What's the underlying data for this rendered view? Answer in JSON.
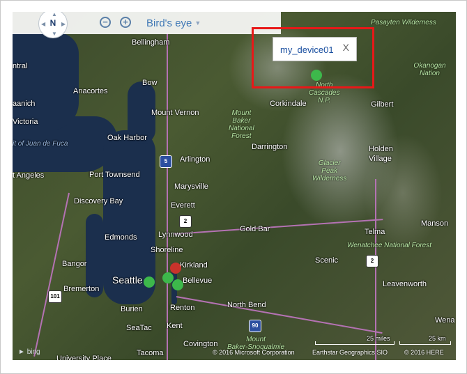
{
  "controls": {
    "compass_label": "N",
    "zoom_out": "−",
    "zoom_in": "+",
    "map_style": "Bird's eye"
  },
  "popup": {
    "title": "my_device01",
    "close": "X"
  },
  "places": {
    "bellingham": "Bellingham",
    "bow": "Bow",
    "anacortes": "Anacortes",
    "central": "ntral",
    "anich": "aanich",
    "victoria": "Victoria",
    "strait": "it of Juan de Fuca",
    "mount_vernon": "Mount Vernon",
    "oak_harbor": "Oak Harbor",
    "arlington": "Arlington",
    "port_angeles": "t Angeles",
    "port_townsend": "Port Townsend",
    "marysville": "Marysville",
    "discovery_bay": "Discovery Bay",
    "everett": "Everett",
    "lynnwood": "Lynnwood",
    "edmonds": "Edmonds",
    "shoreline": "Shoreline",
    "bangor": "Bangor",
    "kirkland": "Kirkland",
    "seattle": "Seattle",
    "bellevue": "Bellevue",
    "bremerton": "Bremerton",
    "burien": "Burien",
    "renton": "Renton",
    "seatac": "SeaTac",
    "kent": "Kent",
    "covington": "Covington",
    "tacoma": "Tacoma",
    "university_place": "University Place",
    "north_bend": "North Bend",
    "gold_bar": "Gold Bar",
    "darrington": "Darrington",
    "corkindale": "Corkindale",
    "gilbert": "Gilbert",
    "holden_village": "Holden\nVillage",
    "telma": "Telma",
    "manson": "Manson",
    "scenic": "Scenic",
    "leavenworth": "Leavenworth",
    "wena": "Wena"
  },
  "parks": {
    "pasayten": "Pasayten Wilderness",
    "okanogan": "Okanogan Nation",
    "north_cascades": "North\nCascades\nN.P.",
    "mount_baker": "Mount\nBaker\nNational\nForest",
    "glacier_peak": "Glacier\nPeak\nWilderness",
    "wenatchee": "Wenatchee National Forest",
    "mount_baker_snoqualmie": "Mount\nBaker-Snoqualmie"
  },
  "shields": {
    "i5": "5",
    "r2a": "2",
    "r2b": "2",
    "r101": "101",
    "i90": "90"
  },
  "scale": {
    "miles": "25 miles",
    "km": "25 km"
  },
  "credits": {
    "bing": "bing",
    "microsoft": "© 2016 Microsoft Corporation",
    "earthstar": "Earthstar Geographics SIO",
    "here": "© 2016 HERE"
  },
  "markers": {
    "colors": {
      "online": "#3db84b",
      "alert": "#c8332b",
      "highlight": "#e81818"
    }
  }
}
